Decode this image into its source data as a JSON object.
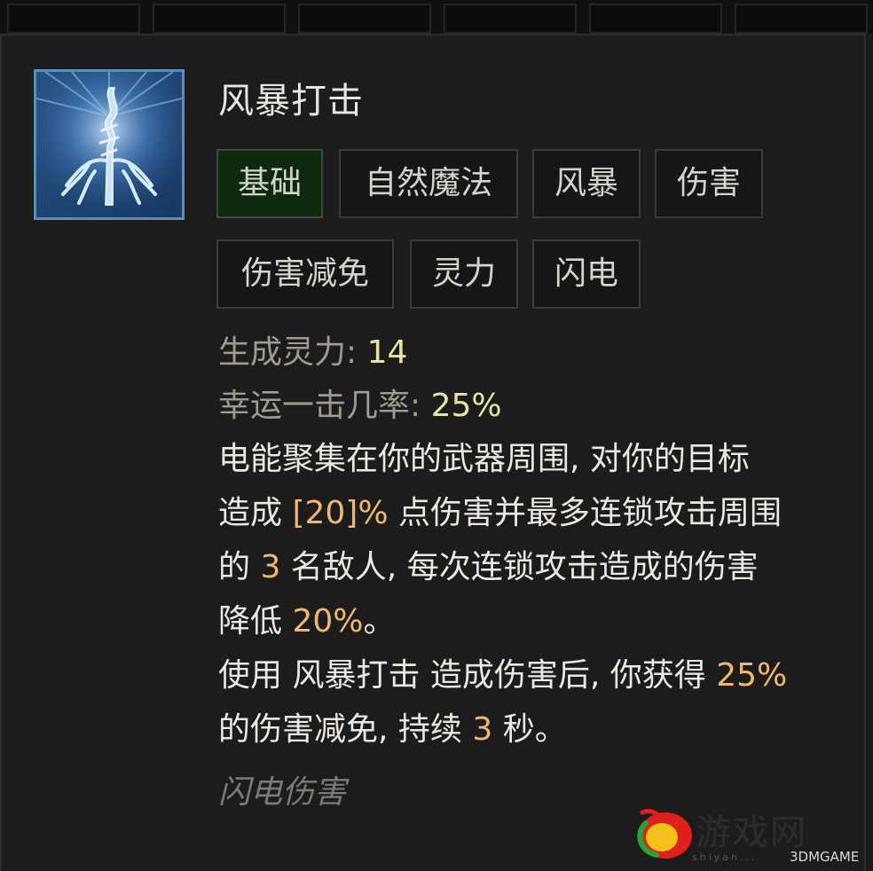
{
  "skill": {
    "name": "风暴打击",
    "icon": "lightning-staff-icon"
  },
  "tags": [
    {
      "label": "基础",
      "active": true
    },
    {
      "label": "自然魔法",
      "active": false
    },
    {
      "label": "风暴",
      "active": false
    },
    {
      "label": "伤害",
      "active": false
    },
    {
      "label": "伤害减免",
      "active": false
    },
    {
      "label": "灵力",
      "active": false
    },
    {
      "label": "闪电",
      "active": false
    }
  ],
  "stats": {
    "spirit_label": "生成灵力: ",
    "spirit_value": "14",
    "luck_label": "幸运一击几率: ",
    "luck_value": "25%"
  },
  "description": {
    "line1": "电能聚集在你的武器周围, 对你的目标",
    "line2_a": "造成 ",
    "line2_hl": "[20]%",
    "line2_b": " 点伤害并最多连锁攻击周围",
    "line3_a": "的 ",
    "line3_hl": "3",
    "line3_b": " 名敌人, 每次连锁攻击造成的伤害",
    "line4_a": "降低 ",
    "line4_hl": "20%",
    "line4_b": "。",
    "line5_a": "使用 ",
    "line5_skill": "风暴打击",
    "line5_b": " 造成伤害后, 你获得 ",
    "line5_hl": "25%",
    "line6_a": "的伤害减免, 持续 ",
    "line6_hl": "3",
    "line6_b": " 秒。"
  },
  "damage_type": "闪电伤害",
  "watermark": {
    "text": "游戏网",
    "brand": "3DMGAME",
    "url": "shiyan..."
  },
  "colors": {
    "highlight": "#f0b770",
    "stat_value": "#e8e4a8",
    "active_tag_bg": "#0d2a0f"
  }
}
